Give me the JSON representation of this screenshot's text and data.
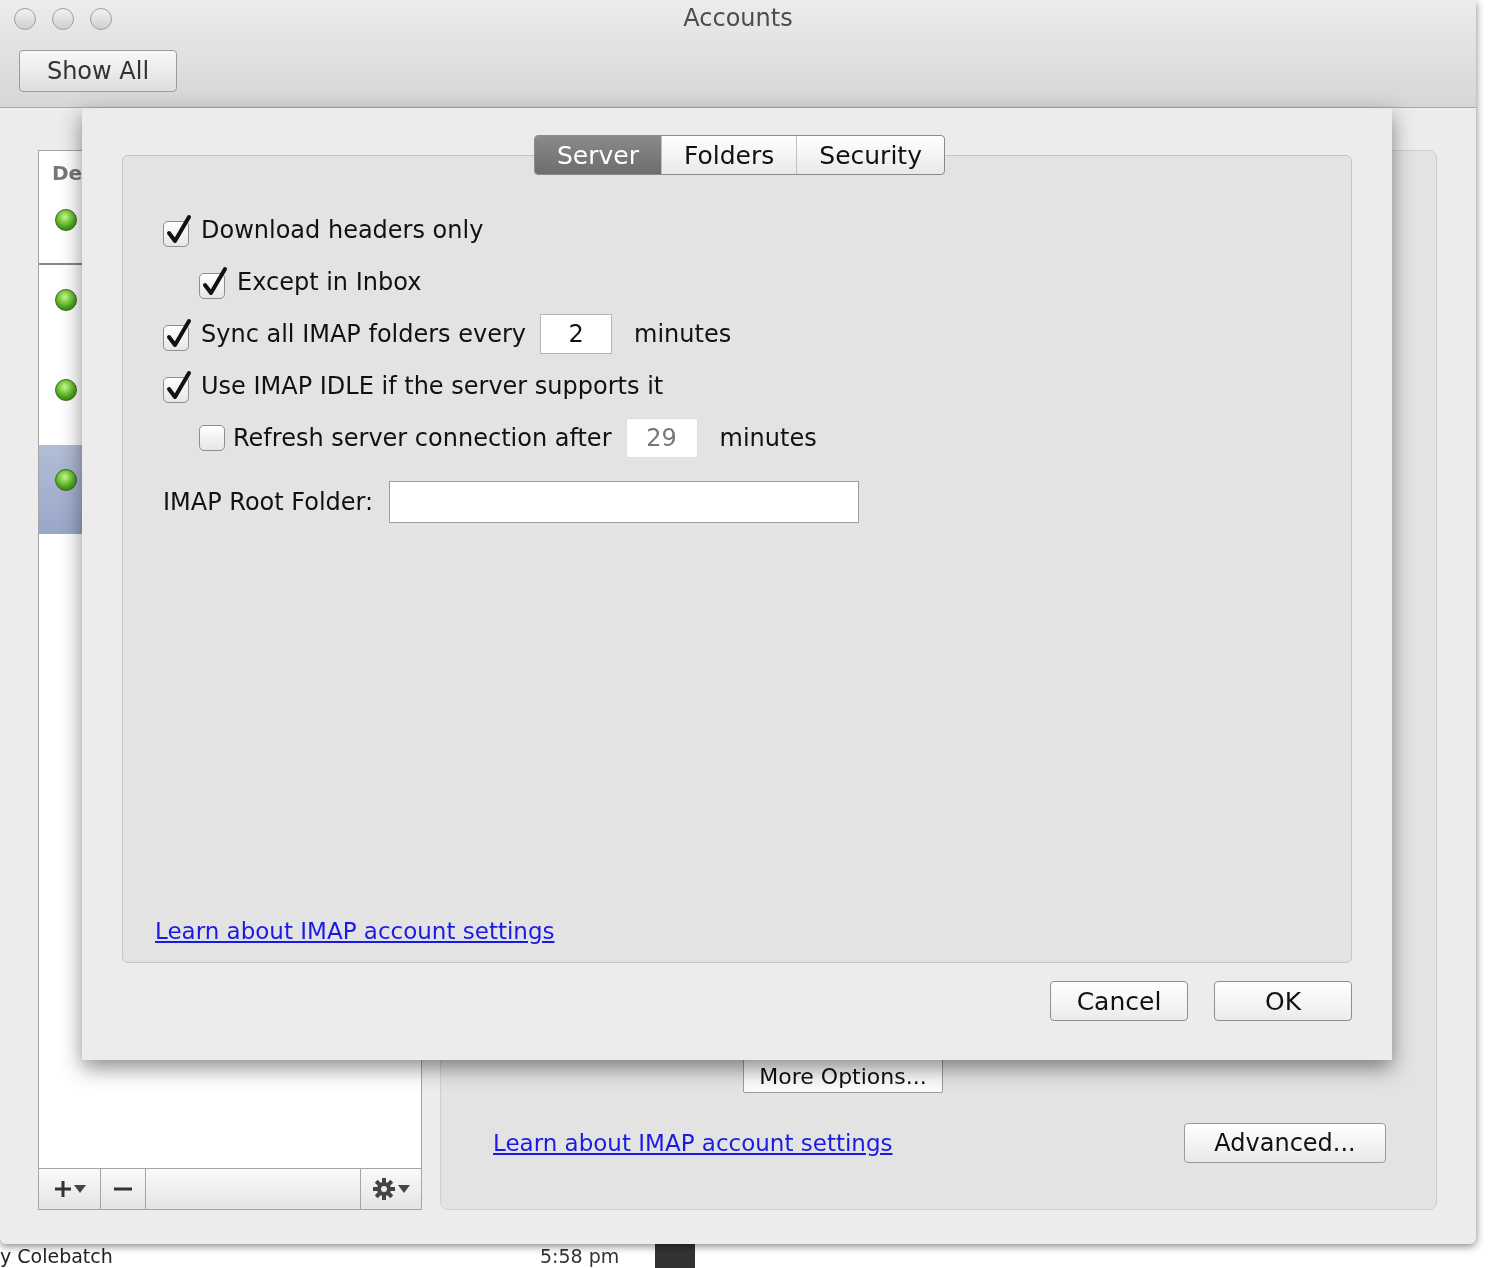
{
  "window": {
    "title": "Accounts",
    "show_all": "Show All"
  },
  "sidebar": {
    "header": "De",
    "items": [
      {
        "selected": false
      },
      {
        "selected": false
      },
      {
        "selected": false
      },
      {
        "selected": true
      }
    ]
  },
  "account_panel": {
    "more_options": "More Options...",
    "link": "Learn about IMAP account settings",
    "advanced": "Advanced..."
  },
  "sheet": {
    "tabs": [
      {
        "label": "Server",
        "selected": true
      },
      {
        "label": "Folders",
        "selected": false
      },
      {
        "label": "Security",
        "selected": false
      }
    ],
    "options": [
      {
        "kind": "checkbox",
        "label": "Download headers only",
        "checked": true,
        "children": [
          {
            "kind": "checkbox",
            "label": "Except in Inbox",
            "checked": true
          }
        ]
      },
      {
        "kind": "checkbox",
        "label": "Sync all IMAP folders every",
        "checked": true,
        "field": {
          "value": "2",
          "disabled": false
        },
        "suffix": "minutes"
      },
      {
        "kind": "checkbox",
        "label": "Use IMAP IDLE if the server supports it",
        "checked": true,
        "children": [
          {
            "kind": "checkbox",
            "label": "Refresh server connection after",
            "checked": false,
            "field": {
              "value": "29",
              "disabled": true
            },
            "suffix": "minutes"
          }
        ]
      },
      {
        "kind": "text_field",
        "label": "IMAP Root Folder:"
      }
    ],
    "link": "Learn about IMAP account settings",
    "buttons": [
      "Cancel",
      "OK"
    ]
  },
  "behind": {
    "name": "y Colebatch",
    "time": "5:58 pm"
  }
}
